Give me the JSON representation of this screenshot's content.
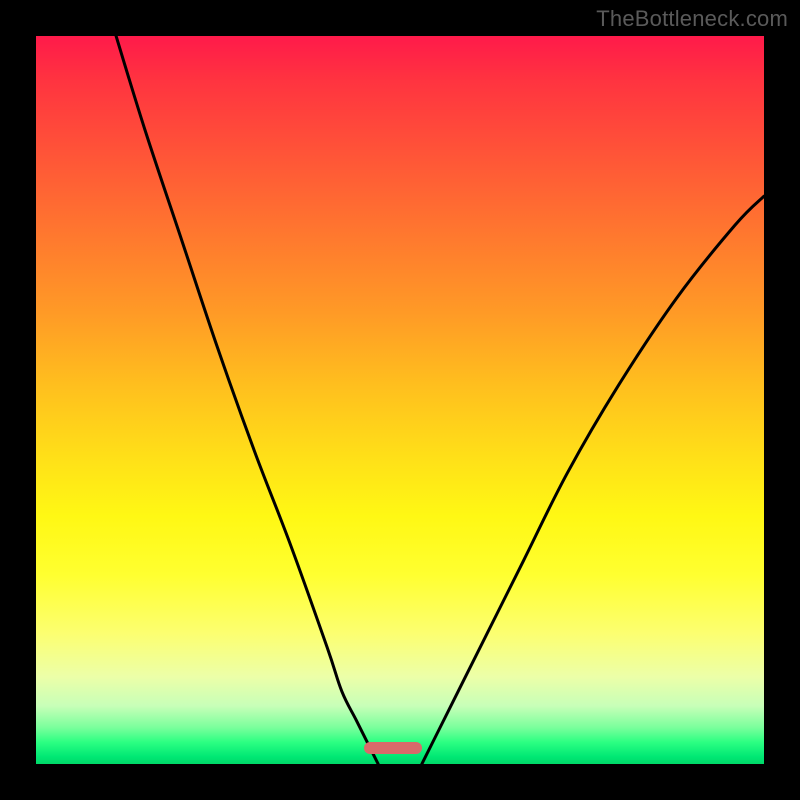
{
  "watermark": {
    "text": "TheBottleneck.com"
  },
  "chart_data": {
    "type": "line",
    "title": "",
    "xlabel": "",
    "ylabel": "",
    "xlim": [
      0,
      100
    ],
    "ylim": [
      0,
      100
    ],
    "grid": false,
    "legend": false,
    "background_gradient": {
      "top_color": "#FF1A4A",
      "middle_color": "#FFE018",
      "bottom_color": "#00D868"
    },
    "series": [
      {
        "name": "left-curve",
        "x": [
          11,
          15,
          20,
          25,
          30,
          35,
          40,
          42,
          44,
          46,
          47
        ],
        "y": [
          100,
          87,
          72,
          57,
          43,
          30,
          16,
          10,
          6,
          2,
          0
        ]
      },
      {
        "name": "right-curve",
        "x": [
          53,
          55,
          58,
          62,
          67,
          73,
          80,
          88,
          96,
          100
        ],
        "y": [
          0,
          4,
          10,
          18,
          28,
          40,
          52,
          64,
          74,
          78
        ]
      }
    ],
    "marker": {
      "x_center": 49,
      "x_width": 8,
      "y": 2.2,
      "height": 1.7,
      "color": "#D96A6A"
    },
    "black_border_px": 36
  }
}
